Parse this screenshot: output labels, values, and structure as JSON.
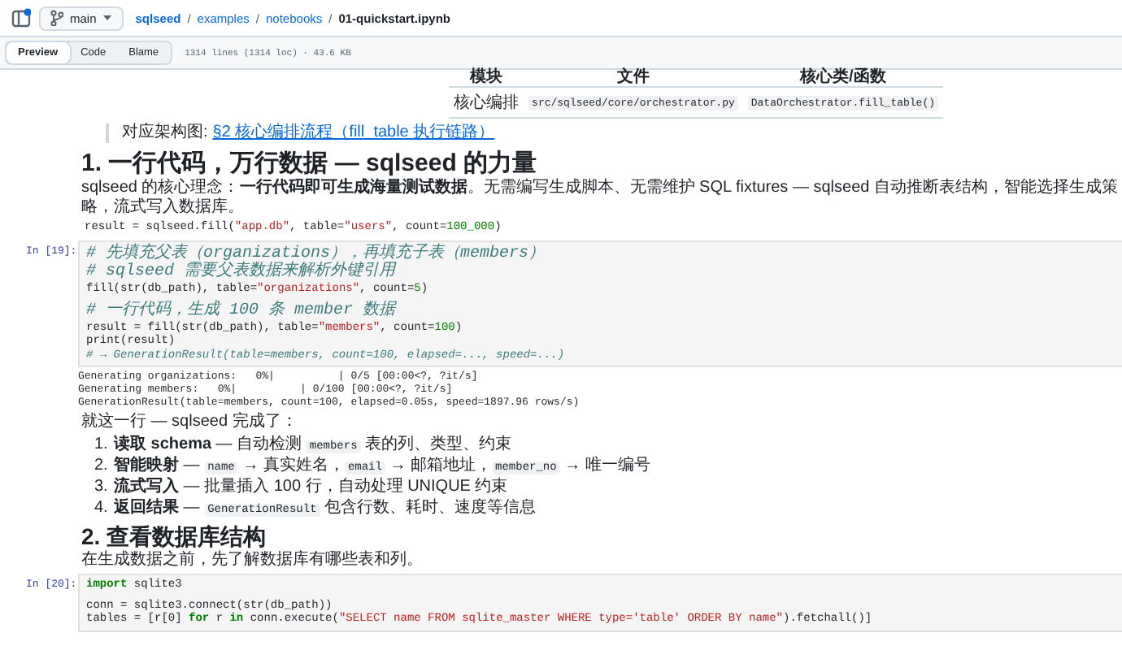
{
  "header": {
    "branch": "main",
    "breadcrumb": [
      {
        "text": "sqlseed",
        "kind": "link"
      },
      {
        "text": "/",
        "kind": "sep"
      },
      {
        "text": "examples",
        "kind": "link"
      },
      {
        "text": "/",
        "kind": "sep"
      },
      {
        "text": "notebooks",
        "kind": "link"
      },
      {
        "text": "/",
        "kind": "sep"
      },
      {
        "text": "01-quickstart.ipynb",
        "kind": "current"
      }
    ]
  },
  "view_tabs": [
    {
      "label": "Preview",
      "selected": true
    },
    {
      "label": "Code",
      "selected": false
    },
    {
      "label": "Blame",
      "selected": false
    }
  ],
  "file_info": "1314 lines (1314 loc) · 43.6 KB",
  "cells": [
    {
      "kind": "table",
      "header": [
        "模块",
        "文件",
        "核心类/函数"
      ],
      "rows": [
        [
          {
            "text": "核心编排",
            "kind": "text"
          },
          {
            "text": "src/sqlseed/core/orchestrator.py",
            "kind": "code"
          },
          {
            "text": "DataOrchestrator.fill_table()",
            "kind": "code"
          }
        ]
      ]
    },
    {
      "kind": "quote",
      "prefix": "对应架构图:",
      "link": "§2 核心编排流程（fill_table 执行链路）"
    },
    {
      "kind": "h1",
      "text": "1. 一行代码，万行数据 — sqlseed 的力量"
    },
    {
      "kind": "para",
      "segments": [
        {
          "text": "sqlseed 的核心理念：**一行代码即可生成海量测试数据**。无需编写生成脚本、无需维护 SQL fixtures — sqlseed 自动推断表结构，智能选择生成策略，流式写入数据库。",
          "kind": "text"
        }
      ]
    },
    {
      "kind": "snippet",
      "lines": [
        {
          "kind": "code",
          "segments": [
            {
              "text": "result = sqlseed.fill(",
              "kind": "plain"
            },
            {
              "text": "\"app.db\"",
              "kind": "str"
            },
            {
              "text": ", table=",
              "kind": "plain"
            },
            {
              "text": "\"users\"",
              "kind": "str"
            },
            {
              "text": ", count=",
              "kind": "plain"
            },
            {
              "text": "100_000",
              "kind": "num"
            },
            {
              "text": ")",
              "kind": "plain"
            }
          ]
        }
      ]
    },
    {
      "kind": "code",
      "prompt": "In [19]:",
      "lines": [
        {
          "kind": "code",
          "segments": [
            {
              "text": "# 先填充父表（organizations），再填充子表（members）",
              "kind": "comment"
            }
          ]
        },
        {
          "kind": "code",
          "segments": [
            {
              "text": "# sqlseed 需要父表数据来解析外键引用",
              "kind": "comment"
            }
          ]
        },
        {
          "kind": "code",
          "segments": [
            {
              "text": "fill(str(db_path), table=",
              "kind": "plain"
            },
            {
              "text": "\"organizations\"",
              "kind": "str"
            },
            {
              "text": ", count=",
              "kind": "plain"
            },
            {
              "text": "5",
              "kind": "num"
            },
            {
              "text": ")",
              "kind": "plain"
            }
          ]
        },
        {
          "kind": "blank"
        },
        {
          "kind": "code",
          "segments": [
            {
              "text": "# 一行代码，生成 100 条 member 数据",
              "kind": "comment"
            }
          ]
        },
        {
          "kind": "code",
          "segments": [
            {
              "text": "result = fill(str(db_path), table=",
              "kind": "plain"
            },
            {
              "text": "\"members\"",
              "kind": "str"
            },
            {
              "text": ", count=",
              "kind": "plain"
            },
            {
              "text": "100",
              "kind": "num"
            },
            {
              "text": ")",
              "kind": "plain"
            }
          ]
        },
        {
          "kind": "code",
          "segments": [
            {
              "text": "print(result)",
              "kind": "plain"
            }
          ]
        },
        {
          "kind": "code",
          "segments": [
            {
              "text": "# → GenerationResult(table=members, count=100, elapsed=..., speed=...)",
              "kind": "comment"
            }
          ]
        }
      ]
    },
    {
      "kind": "output",
      "lines": [
        "Generating organizations:   0%|          | 0/5 [00:00<?, ?it/s]",
        "Generating members:   0%|          | 0/100 [00:00<?, ?it/s]",
        "GenerationResult(table=members, count=100, elapsed=0.05s, speed=1897.96 rows/s)"
      ]
    },
    {
      "kind": "para",
      "segments": [
        {
          "text": "就这一行 — sqlseed 完成了：",
          "kind": "text"
        }
      ]
    },
    {
      "kind": "list",
      "items": [
        {
          "number": "1.",
          "segments": [
            {
              "text": "**读取 schema** — 自动检测 ",
              "kind": "text"
            },
            {
              "text": "members",
              "kind": "code"
            },
            {
              "text": " 表的列、类型、约束",
              "kind": "text"
            }
          ]
        },
        {
          "number": "2.",
          "segments": [
            {
              "text": "**智能映射** — ",
              "kind": "text"
            },
            {
              "text": "name",
              "kind": "code"
            },
            {
              "text": " → 真实姓名，",
              "kind": "text"
            },
            {
              "text": "email",
              "kind": "code"
            },
            {
              "text": " → 邮箱地址，",
              "kind": "text"
            },
            {
              "text": "member_no",
              "kind": "code"
            },
            {
              "text": " → 唯一编号",
              "kind": "text"
            }
          ]
        },
        {
          "number": "3.",
          "segments": [
            {
              "text": "**流式写入** — 批量插入 100 行，自动处理 UNIQUE 约束",
              "kind": "text"
            }
          ]
        },
        {
          "number": "4.",
          "segments": [
            {
              "text": "**返回结果** — ",
              "kind": "text"
            },
            {
              "text": "GenerationResult",
              "kind": "code"
            },
            {
              "text": " 包含行数、耗时、速度等信息",
              "kind": "text"
            }
          ]
        }
      ]
    },
    {
      "kind": "h2",
      "text": "2. 查看数据库结构"
    },
    {
      "kind": "para",
      "segments": [
        {
          "text": "在生成数据之前，先了解数据库有哪些表和列。",
          "kind": "text"
        }
      ]
    },
    {
      "kind": "code",
      "prompt": "In [20]:",
      "lines": [
        {
          "kind": "code",
          "segments": [
            {
              "text": "import",
              "kind": "kw"
            },
            {
              "text": " sqlite3",
              "kind": "plain"
            }
          ]
        },
        {
          "kind": "blank"
        },
        {
          "kind": "code",
          "segments": [
            {
              "text": "conn = sqlite3.connect(str(db_path))",
              "kind": "plain"
            }
          ]
        },
        {
          "kind": "code",
          "segments": [
            {
              "text": "tables = [r[0] ",
              "kind": "plain"
            },
            {
              "text": "for",
              "kind": "kw"
            },
            {
              "text": " r ",
              "kind": "plain"
            },
            {
              "text": "in",
              "kind": "kw"
            },
            {
              "text": " conn.execute(",
              "kind": "plain"
            },
            {
              "text": "\"SELECT name FROM sqlite_master WHERE type='table' ORDER BY name\"",
              "kind": "str"
            },
            {
              "text": ").fetchall()]",
              "kind": "plain"
            }
          ]
        }
      ]
    }
  ]
}
